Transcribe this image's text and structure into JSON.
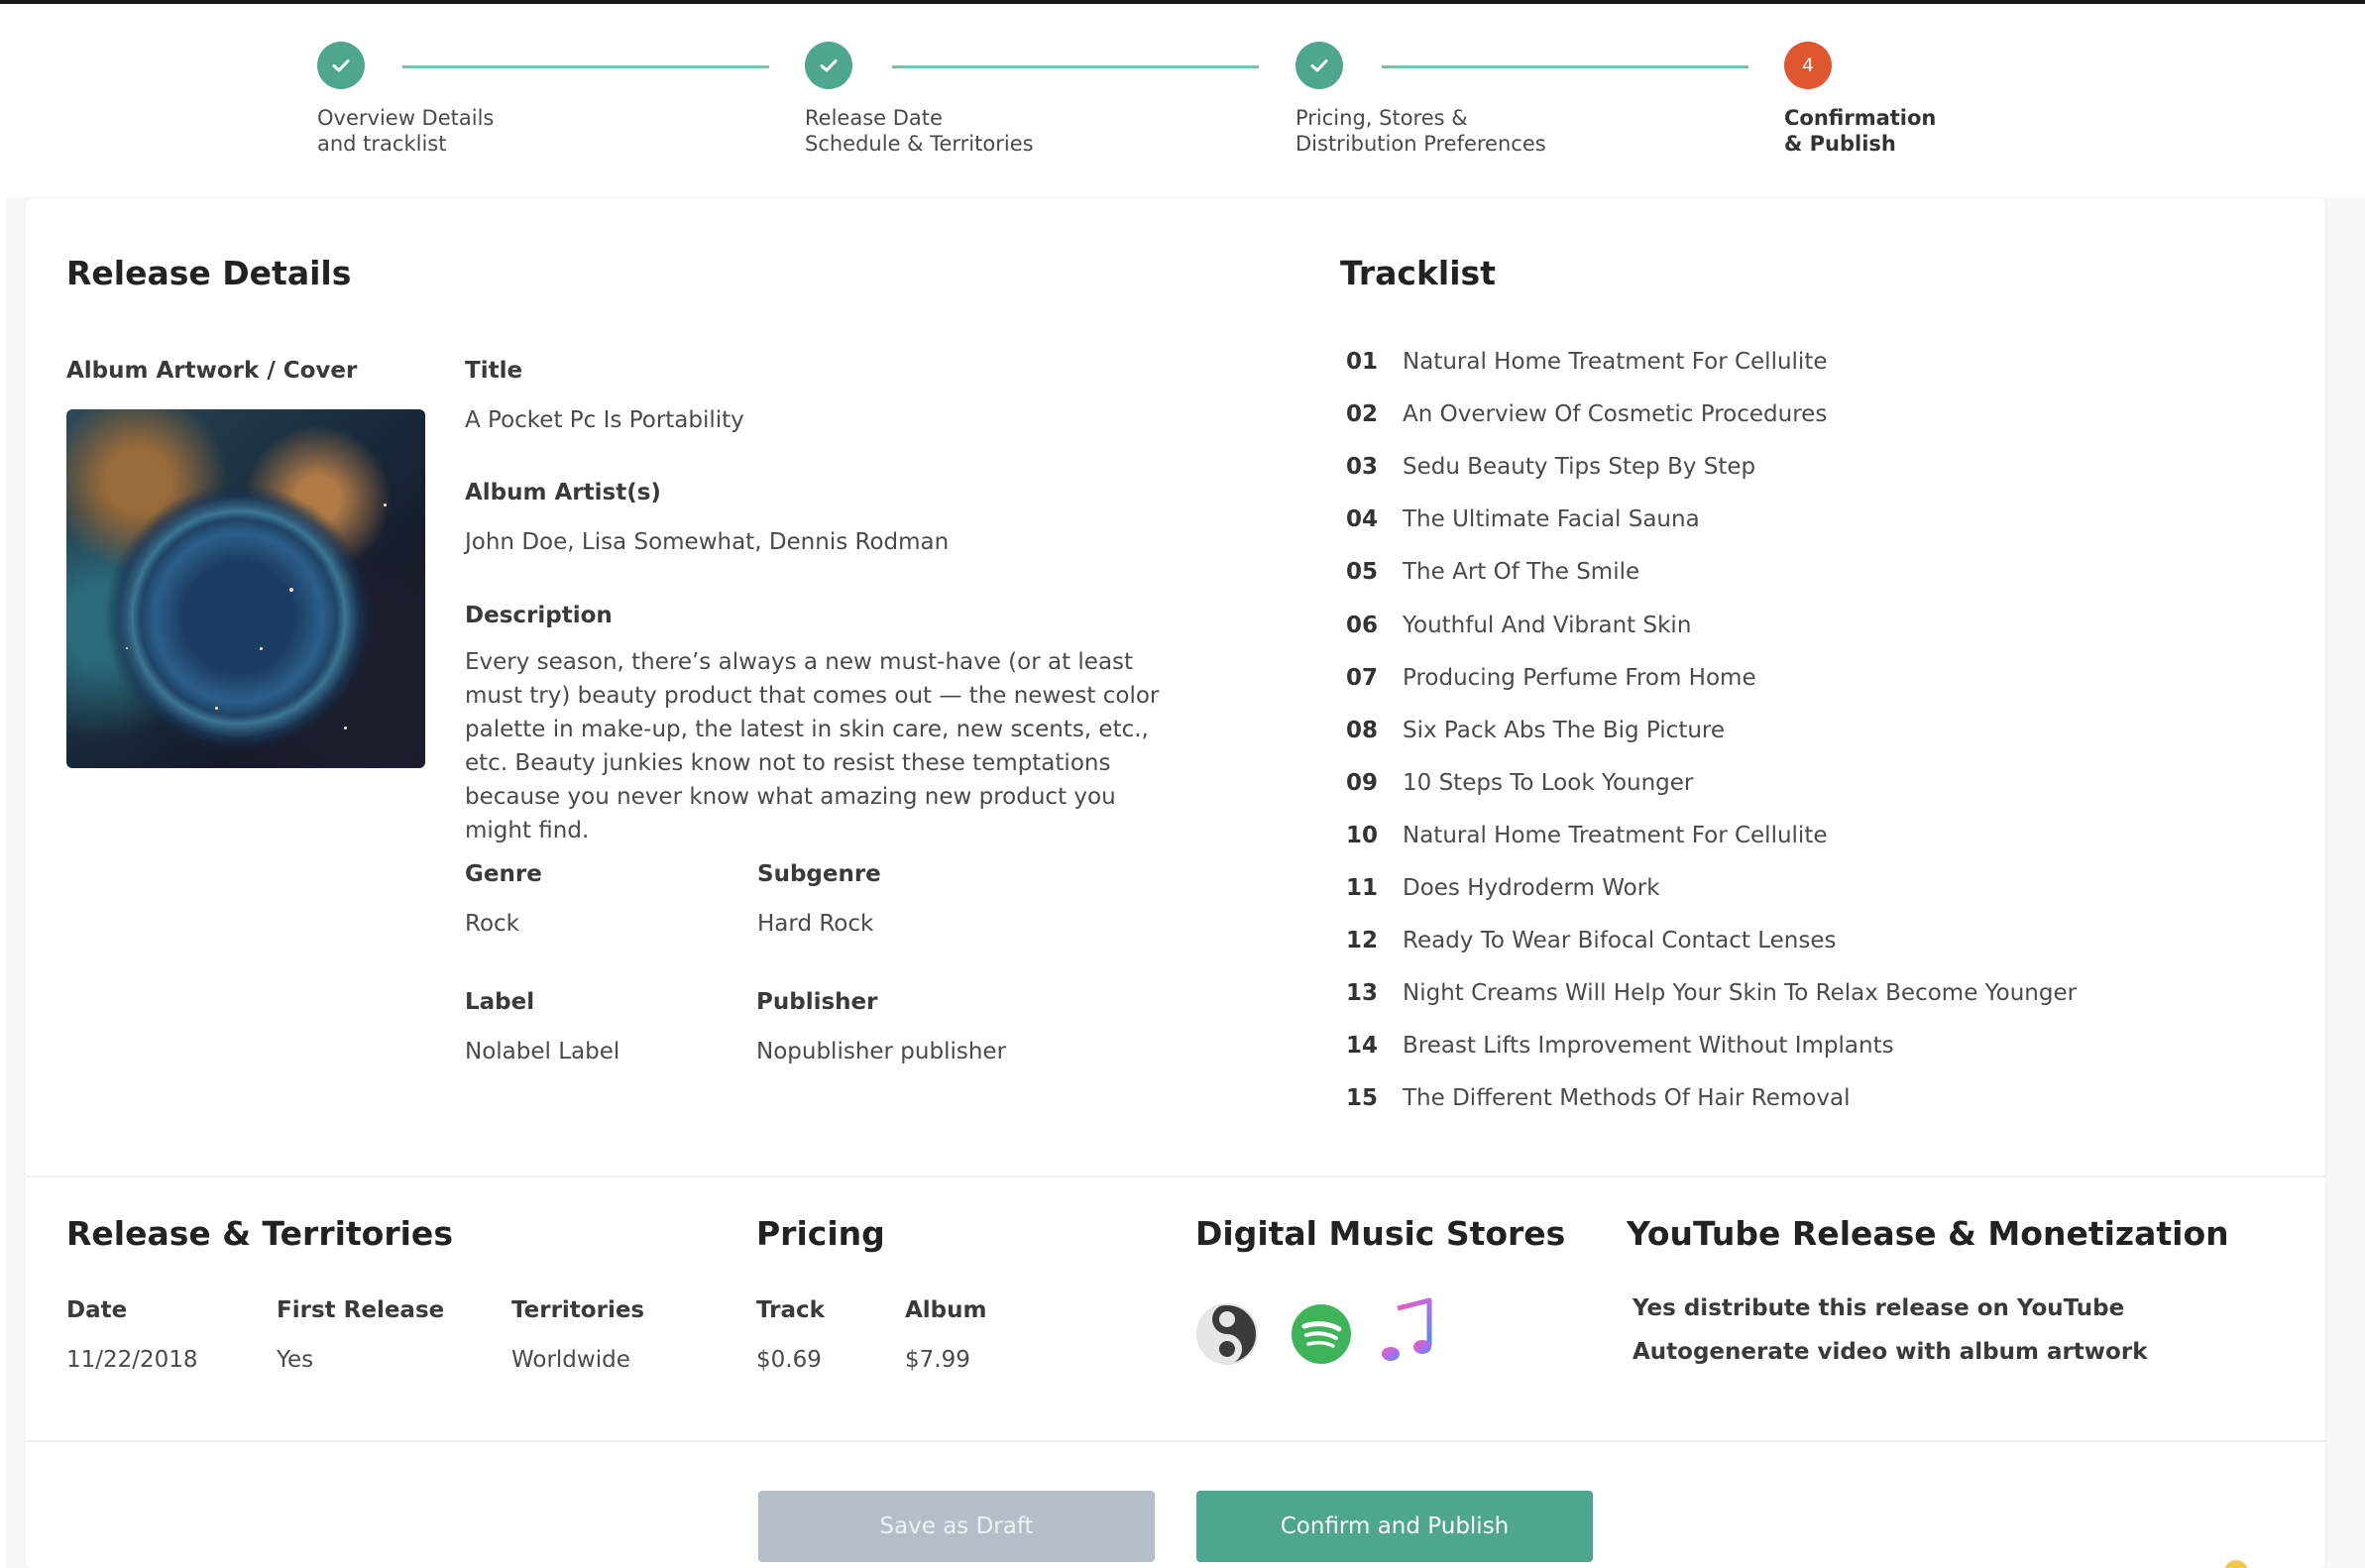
{
  "stepper": {
    "steps": [
      {
        "line1": "Overview Details",
        "line2": "and tracklist",
        "state": "done"
      },
      {
        "line1": "Release Date",
        "line2": "Schedule & Territories",
        "state": "done"
      },
      {
        "line1": "Pricing, Stores &",
        "line2": "Distribution Preferences",
        "state": "done"
      },
      {
        "line1": "Confirmation",
        "line2": "& Publish",
        "state": "active",
        "number": "4"
      }
    ]
  },
  "release_details": {
    "heading": "Release Details",
    "artwork_label": "Album Artwork / Cover",
    "title_label": "Title",
    "title_value": "A Pocket Pc Is Portability",
    "artists_label": "Album Artist(s)",
    "artists_value": "John Doe, Lisa Somewhat, Dennis Rodman",
    "description_label": "Description",
    "description_value": "Every season, there’s always a new must-have (or at least must try) beauty product that comes out — the newest color palette in make-up, the latest in skin care, new scents, etc., etc. Beauty junkies know not to resist these temptations because you never know what amazing new product you might find.",
    "genre_label": "Genre",
    "genre_value": "Rock",
    "subgenre_label": "Subgenre",
    "subgenre_value": "Hard Rock",
    "label_label": "Label",
    "label_value": "Nolabel Label",
    "publisher_label": "Publisher",
    "publisher_value": "Nopublisher publisher"
  },
  "tracklist": {
    "heading": "Tracklist",
    "tracks": [
      {
        "num": "01",
        "title": "Natural Home Treatment For Cellulite"
      },
      {
        "num": "02",
        "title": "An Overview Of Cosmetic Procedures"
      },
      {
        "num": "03",
        "title": "Sedu Beauty Tips Step By Step"
      },
      {
        "num": "04",
        "title": "The Ultimate Facial Sauna"
      },
      {
        "num": "05",
        "title": "The Art Of The Smile"
      },
      {
        "num": "06",
        "title": "Youthful And Vibrant Skin"
      },
      {
        "num": "07",
        "title": "Producing Perfume From Home"
      },
      {
        "num": "08",
        "title": "Six Pack Abs The Big Picture"
      },
      {
        "num": "09",
        "title": "10 Steps To Look Younger"
      },
      {
        "num": "10",
        "title": "Natural Home Treatment For Cellulite"
      },
      {
        "num": "11",
        "title": "Does Hydroderm Work"
      },
      {
        "num": "12",
        "title": "Ready To Wear Bifocal Contact Lenses"
      },
      {
        "num": "13",
        "title": "Night Creams Will Help Your Skin To Relax Become Younger"
      },
      {
        "num": "14",
        "title": "Breast Lifts Improvement Without Implants"
      },
      {
        "num": "15",
        "title": "The Different Methods Of Hair Removal"
      }
    ]
  },
  "territories": {
    "heading": "Release & Territories",
    "date_label": "Date",
    "date_value": "11/22/2018",
    "first_release_label": "First Release",
    "first_release_value": "Yes",
    "territories_label": "Territories",
    "territories_value": "Worldwide"
  },
  "pricing": {
    "heading": "Pricing",
    "track_label": "Track",
    "track_value": "$0.69",
    "album_label": "Album",
    "album_value": "$7.99"
  },
  "stores": {
    "heading": "Digital Music Stores",
    "icons": [
      "deezer-icon",
      "spotify-icon",
      "apple-music-icon"
    ]
  },
  "youtube": {
    "heading": "YouTube Release & Monetization",
    "line1": "Yes distribute this release on YouTube",
    "line2": "Autogenerate video with album artwork"
  },
  "actions": {
    "draft_label": "Save as Draft",
    "publish_label": "Confirm and Publish"
  },
  "colors": {
    "accent": "#4fa68f",
    "active_step": "#e0572f",
    "draft_button": "#b5bec6"
  }
}
